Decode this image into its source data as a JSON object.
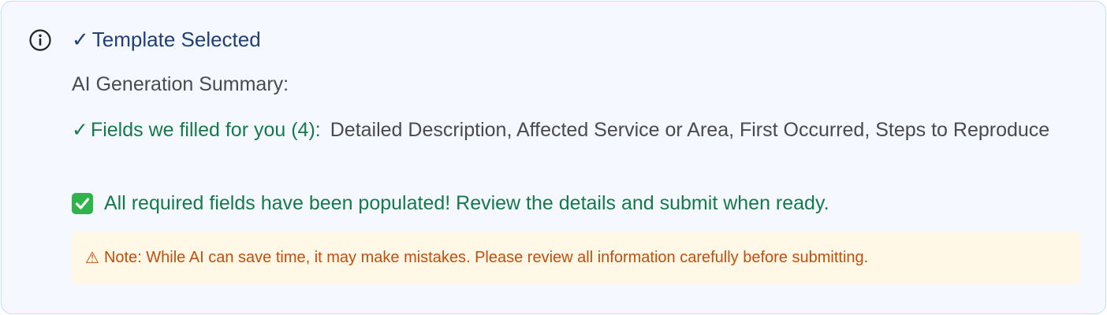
{
  "panel": {
    "title_check": "✓",
    "title": "Template Selected",
    "summary_heading": "AI Generation Summary:",
    "fields": {
      "check": "✓",
      "label": "Fields we filled for you (4):",
      "list": "Detailed Description, Affected Service or Area, First Occurred, Steps to Reproduce"
    },
    "success_message": "All required fields have been populated! Review the details and submit when ready.",
    "note": {
      "icon": "⚠",
      "text": "Note: While AI can save time, it may make mistakes. Please review all information carefully before submitting."
    }
  },
  "icons": {
    "info": "info-circle-icon",
    "success": "check-box-icon",
    "warning": "warning-triangle-icon"
  },
  "colors": {
    "panel_background": "#f5f9ff",
    "panel_border": "#bfe0f7",
    "title": "#1f3f7a",
    "text": "#4a4a4a",
    "success": "#17794a",
    "success_badge": "#2fb44b",
    "note_background": "#fff8e6",
    "note_text": "#c04f0d"
  }
}
